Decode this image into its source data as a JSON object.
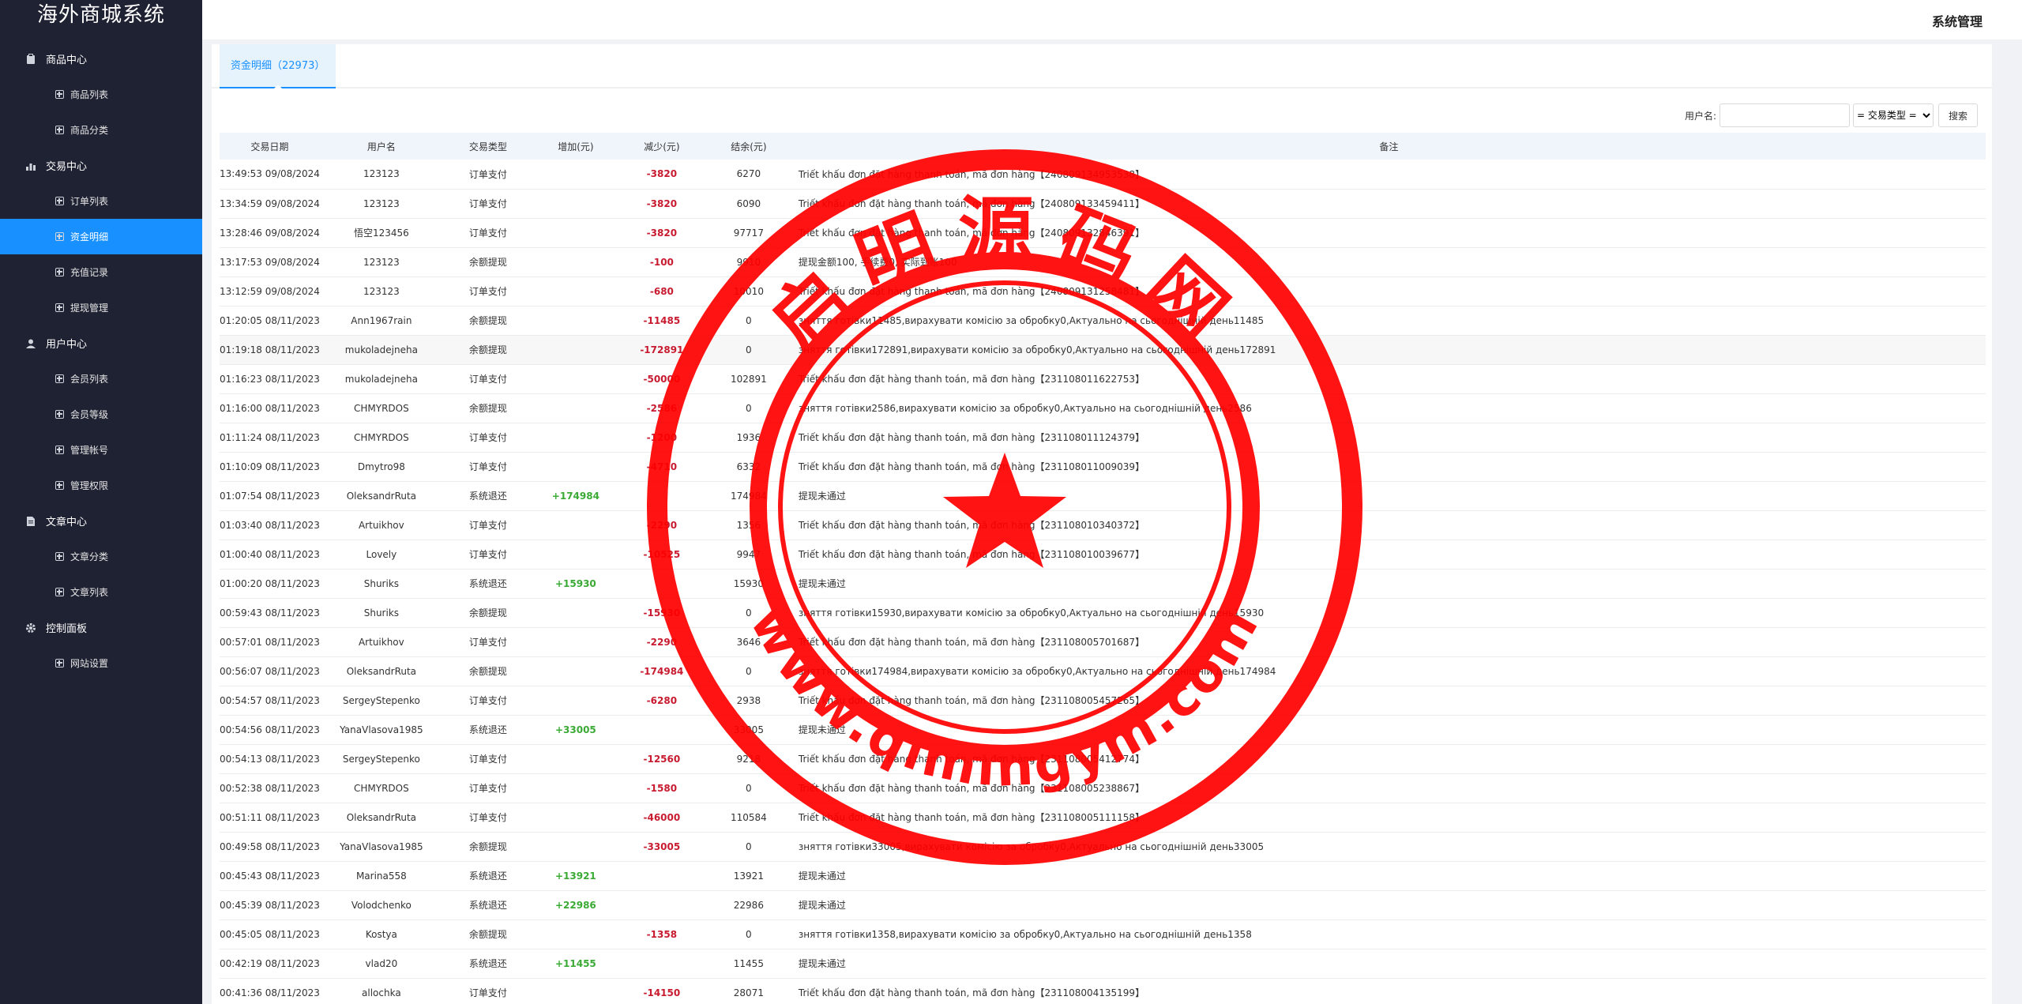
{
  "brand": "海外商城系统",
  "header": {
    "system_label": "系统管理"
  },
  "sidebar": {
    "groups": [
      {
        "title": "商品中心",
        "icon": "clipboard-icon",
        "items": [
          "商品列表",
          "商品分类"
        ]
      },
      {
        "title": "交易中心",
        "icon": "bar-chart-icon",
        "items": [
          "订单列表",
          "资金明细",
          "充值记录",
          "提现管理"
        ]
      },
      {
        "title": "用户中心",
        "icon": "user-icon",
        "items": [
          "会员列表",
          "会员等级",
          "管理帐号",
          "管理权限"
        ]
      },
      {
        "title": "文章中心",
        "icon": "document-icon",
        "items": [
          "文章分类",
          "文章列表"
        ]
      },
      {
        "title": "控制面板",
        "icon": "gear-icon",
        "items": [
          "网站设置"
        ]
      }
    ],
    "active_item": "资金明细"
  },
  "tab": {
    "label": "资金明细（22973）"
  },
  "toolbar": {
    "username_label": "用户名:",
    "username_value": "",
    "type_select": "= 交易类型 =",
    "search_label": "搜索"
  },
  "table": {
    "headers": [
      "交易日期",
      "用户名",
      "交易类型",
      "增加(元)",
      "减少(元)",
      "结余(元)",
      "备注"
    ],
    "rows": [
      [
        "13:49:53 09/08/2024",
        "123123",
        "订单支付",
        "",
        "-3820",
        "6270",
        "Triết khấu đơn đặt hàng thanh toán, mã đơn hàng【240809134953538】"
      ],
      [
        "13:34:59 09/08/2024",
        "123123",
        "订单支付",
        "",
        "-3820",
        "6090",
        "Triết khấu đơn đặt hàng thanh toán, mã đơn hàng【240809133459411】"
      ],
      [
        "13:28:46 09/08/2024",
        "悟空123456",
        "订单支付",
        "",
        "-3820",
        "97717",
        "Triết khấu đơn đặt hàng thanh toán, mã đơn hàng【240809132846391】"
      ],
      [
        "13:17:53 09/08/2024",
        "123123",
        "余额提现",
        "",
        "-100",
        "9910",
        "提现金额100, 手续费0, 实际到账100"
      ],
      [
        "13:12:59 09/08/2024",
        "123123",
        "订单支付",
        "",
        "-680",
        "10010",
        "Triết khấu đơn đặt hàng thanh toán, mã đơn hàng【240809131258481】"
      ],
      [
        "01:20:05 08/11/2023",
        "Ann1967rain",
        "余额提现",
        "",
        "-11485",
        "0",
        "зняття готівки11485,вирахувати комісію за обробку0,Актуально на сьогоднішній день11485"
      ],
      [
        "01:19:18 08/11/2023",
        "mukoladejneha",
        "余额提现",
        "",
        "-172891",
        "0",
        "зняття готівки172891,вирахувати комісію за обробку0,Актуально на сьогоднішній день172891"
      ],
      [
        "01:16:23 08/11/2023",
        "mukoladejneha",
        "订单支付",
        "",
        "-50000",
        "102891",
        "Triết khấu đơn đặt hàng thanh toán, mã đơn hàng【231108011622753】"
      ],
      [
        "01:16:00 08/11/2023",
        "CHMYRDOS",
        "余额提现",
        "",
        "-2586",
        "0",
        "зняття готівки2586,вирахувати комісію за обробку0,Актуально на сьогоднішній день2586"
      ],
      [
        "01:11:24 08/11/2023",
        "CHMYRDOS",
        "订单支付",
        "",
        "-1200",
        "1936",
        "Triết khấu đơn đặt hàng thanh toán, mã đơn hàng【231108011124379】"
      ],
      [
        "01:10:09 08/11/2023",
        "Dmytro98",
        "订单支付",
        "",
        "-4710",
        "6332",
        "Triết khấu đơn đặt hàng thanh toán, mã đơn hàng【231108011009039】"
      ],
      [
        "01:07:54 08/11/2023",
        "OleksandrRuta",
        "系统退还",
        "+174984",
        "",
        "174984",
        "提现未通过"
      ],
      [
        "01:03:40 08/11/2023",
        "Artuikhov",
        "订单支付",
        "",
        "-2290",
        "1356",
        "Triết khấu đơn đặt hàng thanh toán, mã đơn hàng【231108010340372】"
      ],
      [
        "01:00:40 08/11/2023",
        "Lovely",
        "订单支付",
        "",
        "-10525",
        "9947",
        "Triết khấu đơn đặt hàng thanh toán, mã đơn hàng【231108010039677】"
      ],
      [
        "01:00:20 08/11/2023",
        "Shuriks",
        "系统退还",
        "+15930",
        "",
        "15930",
        "提现未通过"
      ],
      [
        "00:59:43 08/11/2023",
        "Shuriks",
        "余额提现",
        "",
        "-15930",
        "0",
        "зняття готівки15930,вирахувати комісію за обробку0,Актуально на сьогоднішній день15930"
      ],
      [
        "00:57:01 08/11/2023",
        "Artuikhov",
        "订单支付",
        "",
        "-2290",
        "3646",
        "Triết khấu đơn đặt hàng thanh toán, mã đơn hàng【231108005701687】"
      ],
      [
        "00:56:07 08/11/2023",
        "OleksandrRuta",
        "余额提现",
        "",
        "-174984",
        "0",
        "зняття готівки174984,вирахувати комісію за обробку0,Актуально на сьогоднішній день174984"
      ],
      [
        "00:54:57 08/11/2023",
        "SergeyStepenko",
        "订单支付",
        "",
        "-6280",
        "2938",
        "Triết khấu đơn đặt hàng thanh toán, mã đơn hàng【231108005457265】"
      ],
      [
        "00:54:56 08/11/2023",
        "YanaVlasova1985",
        "系统退还",
        "+33005",
        "",
        "33005",
        "提现未通过"
      ],
      [
        "00:54:13 08/11/2023",
        "SergeyStepenko",
        "订单支付",
        "",
        "-12560",
        "9218",
        "Triết khấu đơn đặt hàng thanh toán, mã đơn hàng【231108005412774】"
      ],
      [
        "00:52:38 08/11/2023",
        "CHMYRDOS",
        "订单支付",
        "",
        "-1580",
        "0",
        "Triết khấu đơn đặt hàng thanh toán, mã đơn hàng【231108005238867】"
      ],
      [
        "00:51:11 08/11/2023",
        "OleksandrRuta",
        "订单支付",
        "",
        "-46000",
        "110584",
        "Triết khấu đơn đặt hàng thanh toán, mã đơn hàng【231108005111158】"
      ],
      [
        "00:49:58 08/11/2023",
        "YanaVlasova1985",
        "余额提现",
        "",
        "-33005",
        "0",
        "зняття готівки33005,вирахувати комісію за обробку0,Актуально на сьогоднішній день33005"
      ],
      [
        "00:45:43 08/11/2023",
        "Marina558",
        "系统退还",
        "+13921",
        "",
        "13921",
        "提现未通过"
      ],
      [
        "00:45:39 08/11/2023",
        "Volodchenko",
        "系统退还",
        "+22986",
        "",
        "22986",
        "提现未通过"
      ],
      [
        "00:45:05 08/11/2023",
        "Kostya",
        "余额提现",
        "",
        "-1358",
        "0",
        "зняття готівки1358,вирахувати комісію за обробку0,Актуально на сьогоднішній день1358"
      ],
      [
        "00:42:19 08/11/2023",
        "vlad20",
        "系统退还",
        "+11455",
        "",
        "11455",
        "提现未通过"
      ],
      [
        "00:41:36 08/11/2023",
        "allochka",
        "订单支付",
        "",
        "-14150",
        "28071",
        "Triết khấu đơn đặt hàng thanh toán, mã đơn hàng【231108004135199】"
      ]
    ]
  },
  "watermark": {
    "top_text": "启明源码网",
    "bottom_text": "www.qimingym.com",
    "color": "#ff0000"
  }
}
